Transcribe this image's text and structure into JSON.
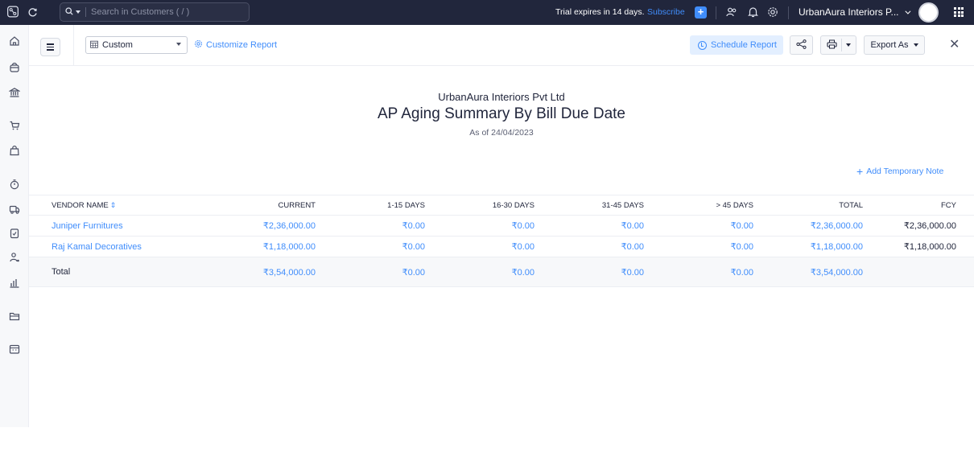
{
  "topbar": {
    "search_placeholder": "Search in Customers ( / )",
    "trial_text": "Trial expires in 14 days.",
    "subscribe_label": "Subscribe",
    "org_name": "UrbanAura Interiors P...",
    "accent": "#408dfb"
  },
  "toolbar": {
    "period_select": "Custom",
    "customize_label": "Customize Report",
    "schedule_label": "Schedule Report",
    "export_label": "Export As"
  },
  "report": {
    "company": "UrbanAura Interiors Pvt Ltd",
    "title": "AP Aging Summary By Bill Due Date",
    "as_of": "As of 24/04/2023",
    "add_note_label": "Add Temporary Note",
    "columns": [
      "VENDOR NAME",
      "CURRENT",
      "1-15 DAYS",
      "16-30 DAYS",
      "31-45 DAYS",
      "> 45 DAYS",
      "TOTAL",
      "FCY"
    ],
    "rows": [
      {
        "vendor": "Juniper Furnitures",
        "current": "₹2,36,000.00",
        "d1_15": "₹0.00",
        "d16_30": "₹0.00",
        "d31_45": "₹0.00",
        "d45": "₹0.00",
        "total": "₹2,36,000.00",
        "fcy": "₹2,36,000.00"
      },
      {
        "vendor": "Raj Kamal Decoratives",
        "current": "₹1,18,000.00",
        "d1_15": "₹0.00",
        "d16_30": "₹0.00",
        "d31_45": "₹0.00",
        "d45": "₹0.00",
        "total": "₹1,18,000.00",
        "fcy": "₹1,18,000.00"
      }
    ],
    "totals": {
      "label": "Total",
      "current": "₹3,54,000.00",
      "d1_15": "₹0.00",
      "d16_30": "₹0.00",
      "d31_45": "₹0.00",
      "d45": "₹0.00",
      "total": "₹3,54,000.00",
      "fcy": ""
    }
  },
  "sidebar_icons": [
    "home-icon",
    "bag-icon",
    "bank-icon",
    "cart-icon",
    "shopping-bag-icon",
    "timer-icon",
    "truck-icon",
    "document-icon",
    "users-icon",
    "reports-icon",
    "folder-icon",
    "calendar-icon"
  ]
}
